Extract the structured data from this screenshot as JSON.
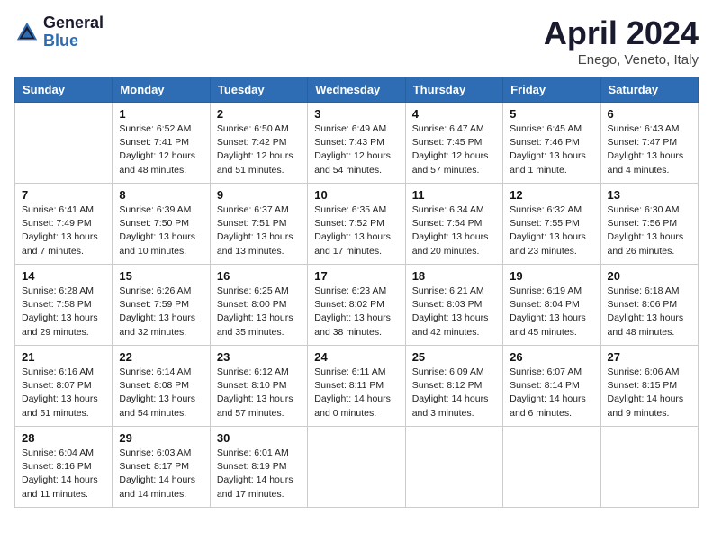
{
  "header": {
    "logo_general": "General",
    "logo_blue": "Blue",
    "month_title": "April 2024",
    "location": "Enego, Veneto, Italy"
  },
  "days_of_week": [
    "Sunday",
    "Monday",
    "Tuesday",
    "Wednesday",
    "Thursday",
    "Friday",
    "Saturday"
  ],
  "weeks": [
    [
      {
        "date": "",
        "info": ""
      },
      {
        "date": "1",
        "info": "Sunrise: 6:52 AM\nSunset: 7:41 PM\nDaylight: 12 hours\nand 48 minutes."
      },
      {
        "date": "2",
        "info": "Sunrise: 6:50 AM\nSunset: 7:42 PM\nDaylight: 12 hours\nand 51 minutes."
      },
      {
        "date": "3",
        "info": "Sunrise: 6:49 AM\nSunset: 7:43 PM\nDaylight: 12 hours\nand 54 minutes."
      },
      {
        "date": "4",
        "info": "Sunrise: 6:47 AM\nSunset: 7:45 PM\nDaylight: 12 hours\nand 57 minutes."
      },
      {
        "date": "5",
        "info": "Sunrise: 6:45 AM\nSunset: 7:46 PM\nDaylight: 13 hours\nand 1 minute."
      },
      {
        "date": "6",
        "info": "Sunrise: 6:43 AM\nSunset: 7:47 PM\nDaylight: 13 hours\nand 4 minutes."
      }
    ],
    [
      {
        "date": "7",
        "info": "Sunrise: 6:41 AM\nSunset: 7:49 PM\nDaylight: 13 hours\nand 7 minutes."
      },
      {
        "date": "8",
        "info": "Sunrise: 6:39 AM\nSunset: 7:50 PM\nDaylight: 13 hours\nand 10 minutes."
      },
      {
        "date": "9",
        "info": "Sunrise: 6:37 AM\nSunset: 7:51 PM\nDaylight: 13 hours\nand 13 minutes."
      },
      {
        "date": "10",
        "info": "Sunrise: 6:35 AM\nSunset: 7:52 PM\nDaylight: 13 hours\nand 17 minutes."
      },
      {
        "date": "11",
        "info": "Sunrise: 6:34 AM\nSunset: 7:54 PM\nDaylight: 13 hours\nand 20 minutes."
      },
      {
        "date": "12",
        "info": "Sunrise: 6:32 AM\nSunset: 7:55 PM\nDaylight: 13 hours\nand 23 minutes."
      },
      {
        "date": "13",
        "info": "Sunrise: 6:30 AM\nSunset: 7:56 PM\nDaylight: 13 hours\nand 26 minutes."
      }
    ],
    [
      {
        "date": "14",
        "info": "Sunrise: 6:28 AM\nSunset: 7:58 PM\nDaylight: 13 hours\nand 29 minutes."
      },
      {
        "date": "15",
        "info": "Sunrise: 6:26 AM\nSunset: 7:59 PM\nDaylight: 13 hours\nand 32 minutes."
      },
      {
        "date": "16",
        "info": "Sunrise: 6:25 AM\nSunset: 8:00 PM\nDaylight: 13 hours\nand 35 minutes."
      },
      {
        "date": "17",
        "info": "Sunrise: 6:23 AM\nSunset: 8:02 PM\nDaylight: 13 hours\nand 38 minutes."
      },
      {
        "date": "18",
        "info": "Sunrise: 6:21 AM\nSunset: 8:03 PM\nDaylight: 13 hours\nand 42 minutes."
      },
      {
        "date": "19",
        "info": "Sunrise: 6:19 AM\nSunset: 8:04 PM\nDaylight: 13 hours\nand 45 minutes."
      },
      {
        "date": "20",
        "info": "Sunrise: 6:18 AM\nSunset: 8:06 PM\nDaylight: 13 hours\nand 48 minutes."
      }
    ],
    [
      {
        "date": "21",
        "info": "Sunrise: 6:16 AM\nSunset: 8:07 PM\nDaylight: 13 hours\nand 51 minutes."
      },
      {
        "date": "22",
        "info": "Sunrise: 6:14 AM\nSunset: 8:08 PM\nDaylight: 13 hours\nand 54 minutes."
      },
      {
        "date": "23",
        "info": "Sunrise: 6:12 AM\nSunset: 8:10 PM\nDaylight: 13 hours\nand 57 minutes."
      },
      {
        "date": "24",
        "info": "Sunrise: 6:11 AM\nSunset: 8:11 PM\nDaylight: 14 hours\nand 0 minutes."
      },
      {
        "date": "25",
        "info": "Sunrise: 6:09 AM\nSunset: 8:12 PM\nDaylight: 14 hours\nand 3 minutes."
      },
      {
        "date": "26",
        "info": "Sunrise: 6:07 AM\nSunset: 8:14 PM\nDaylight: 14 hours\nand 6 minutes."
      },
      {
        "date": "27",
        "info": "Sunrise: 6:06 AM\nSunset: 8:15 PM\nDaylight: 14 hours\nand 9 minutes."
      }
    ],
    [
      {
        "date": "28",
        "info": "Sunrise: 6:04 AM\nSunset: 8:16 PM\nDaylight: 14 hours\nand 11 minutes."
      },
      {
        "date": "29",
        "info": "Sunrise: 6:03 AM\nSunset: 8:17 PM\nDaylight: 14 hours\nand 14 minutes."
      },
      {
        "date": "30",
        "info": "Sunrise: 6:01 AM\nSunset: 8:19 PM\nDaylight: 14 hours\nand 17 minutes."
      },
      {
        "date": "",
        "info": ""
      },
      {
        "date": "",
        "info": ""
      },
      {
        "date": "",
        "info": ""
      },
      {
        "date": "",
        "info": ""
      }
    ]
  ]
}
